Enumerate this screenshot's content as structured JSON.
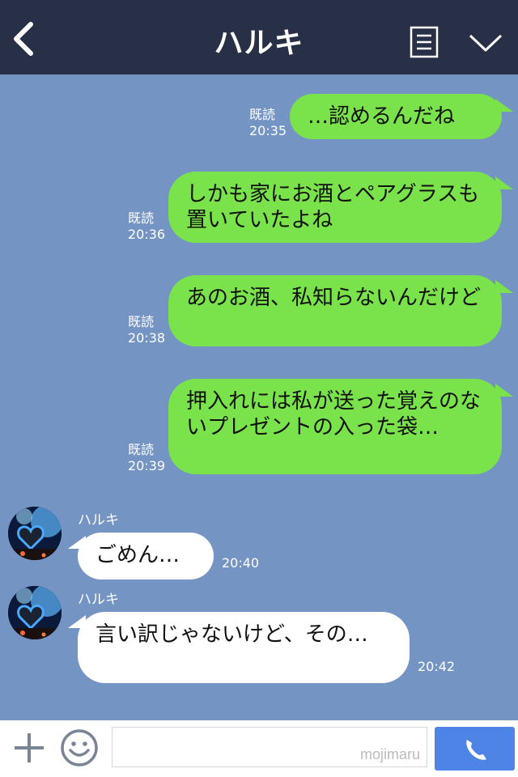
{
  "header": {
    "title": "ハルキ"
  },
  "messages": [
    {
      "status": "既読",
      "time": "20:35",
      "text": "…認めるんだね"
    },
    {
      "status": "既読",
      "time": "20:36",
      "text": "しかも家にお酒とペアグラスも置いていたよね"
    },
    {
      "status": "既読",
      "time": "20:38",
      "text": "あのお酒、私知らないんだけど"
    },
    {
      "status": "既読",
      "time": "20:39",
      "text": "押入れには私が送った覚えのないプレゼントの入った袋…"
    },
    {
      "sender": "ハルキ",
      "time": "20:40",
      "text": "ごめん…"
    },
    {
      "sender": "ハルキ",
      "time": "20:42",
      "text": "言い訳じゃないけど、その…"
    }
  ],
  "input": {
    "placeholder": ""
  },
  "watermark": "mojimaru",
  "colors": {
    "header": "#283048",
    "background": "#7494c4",
    "outgoing": "#7ae24a",
    "incoming": "#ffffff",
    "call": "#4d84e6"
  },
  "icons": [
    "back-icon",
    "menu-icon",
    "chevron-down-icon",
    "plus-icon",
    "smile-icon",
    "phone-icon"
  ]
}
